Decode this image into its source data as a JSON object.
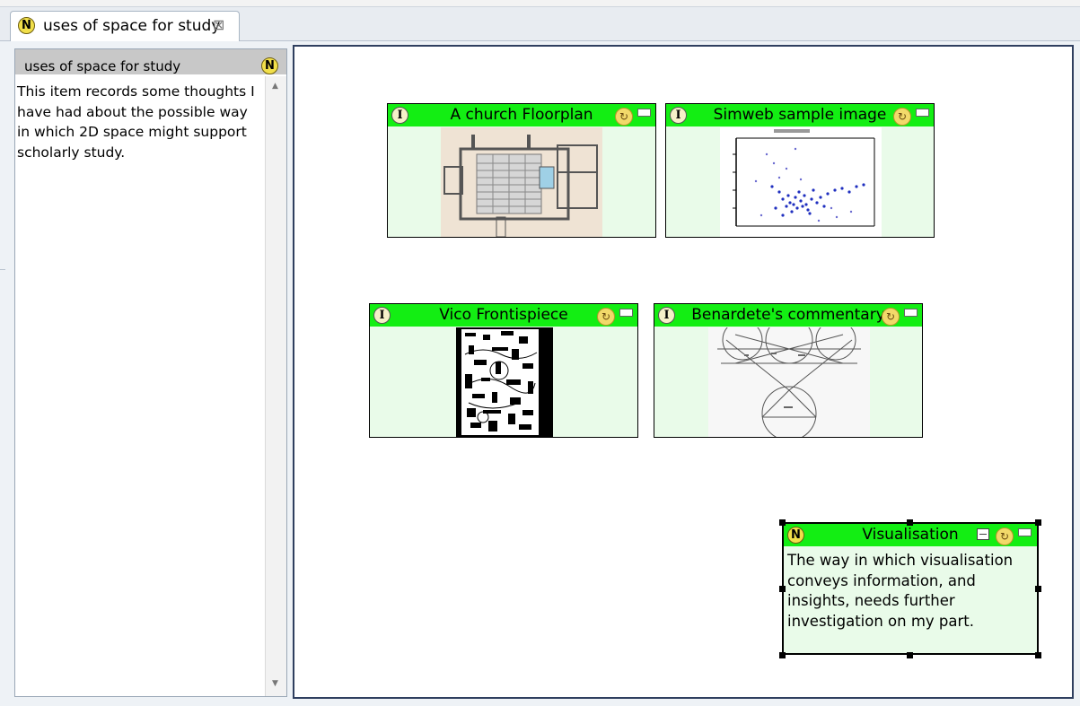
{
  "tab": {
    "icon": "N",
    "title": "uses of space for study",
    "close_glyph": "⊠"
  },
  "side_panel": {
    "title": "uses of space for study",
    "icon": "N",
    "text": "This item records some thoughts I have had about the possible way in which 2D space might support scholarly study."
  },
  "canvas": {
    "items": [
      {
        "title": "A church Floorplan",
        "icon": "I",
        "thumbnail": "church-floorplan-image"
      },
      {
        "title": "Simweb sample image",
        "icon": "I",
        "thumbnail": "scatter-plot-image"
      },
      {
        "title": "Vico Frontispiece",
        "icon": "I",
        "thumbnail": "engraving-image"
      },
      {
        "title": "Benardete's commentary",
        "icon": "I",
        "thumbnail": "geometric-diagram-image"
      }
    ],
    "note": {
      "title": "Visualisation",
      "icon": "N",
      "text": "The way in which visualisation conveys information, and insights, needs further investigation on my part."
    }
  },
  "colors": {
    "item_header": "#13ee13",
    "item_body": "#e9fbe9",
    "canvas_border": "#2f3f5f",
    "icon_yellow": "#f1df4a"
  }
}
